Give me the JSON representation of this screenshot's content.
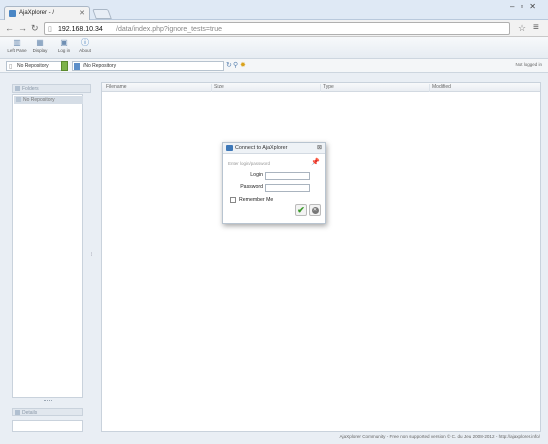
{
  "browser": {
    "tab_title": "AjaXplorer - /",
    "address_host": "192.168.10.34",
    "address_path": "/data/index.php?ignore_tests=true"
  },
  "toolbar": {
    "buttons": [
      {
        "label": "Left Pane",
        "icon": "left-pane-icon"
      },
      {
        "label": "Display",
        "icon": "display-icon"
      },
      {
        "label": "Log in",
        "icon": "login-icon"
      },
      {
        "label": "About",
        "icon": "info-icon"
      }
    ]
  },
  "repobar": {
    "repository": "No Repository",
    "path": "/No Repository",
    "login_status": "Not logged in"
  },
  "left_panel": {
    "folders_header": "Folders",
    "tree_item": "No Repository",
    "details_header": "Details"
  },
  "file_list": {
    "columns": [
      "Filename",
      "Size",
      "Type",
      "Modified"
    ]
  },
  "footer": {
    "text": "AjaXplorer Community - Free non supported version © C. du Jeu 2008-2012 - http://ajaxplorer.info/"
  },
  "dialog": {
    "title": "Connect to AjaXplorer",
    "subtitle": "Enter login/password",
    "login_label": "Login",
    "password_label": "Password",
    "remember_label": "Remember Me"
  },
  "colors": {
    "accent": "#3e78b8",
    "ok": "#3d9a2d",
    "repo_dropdown": "#7db24a"
  }
}
